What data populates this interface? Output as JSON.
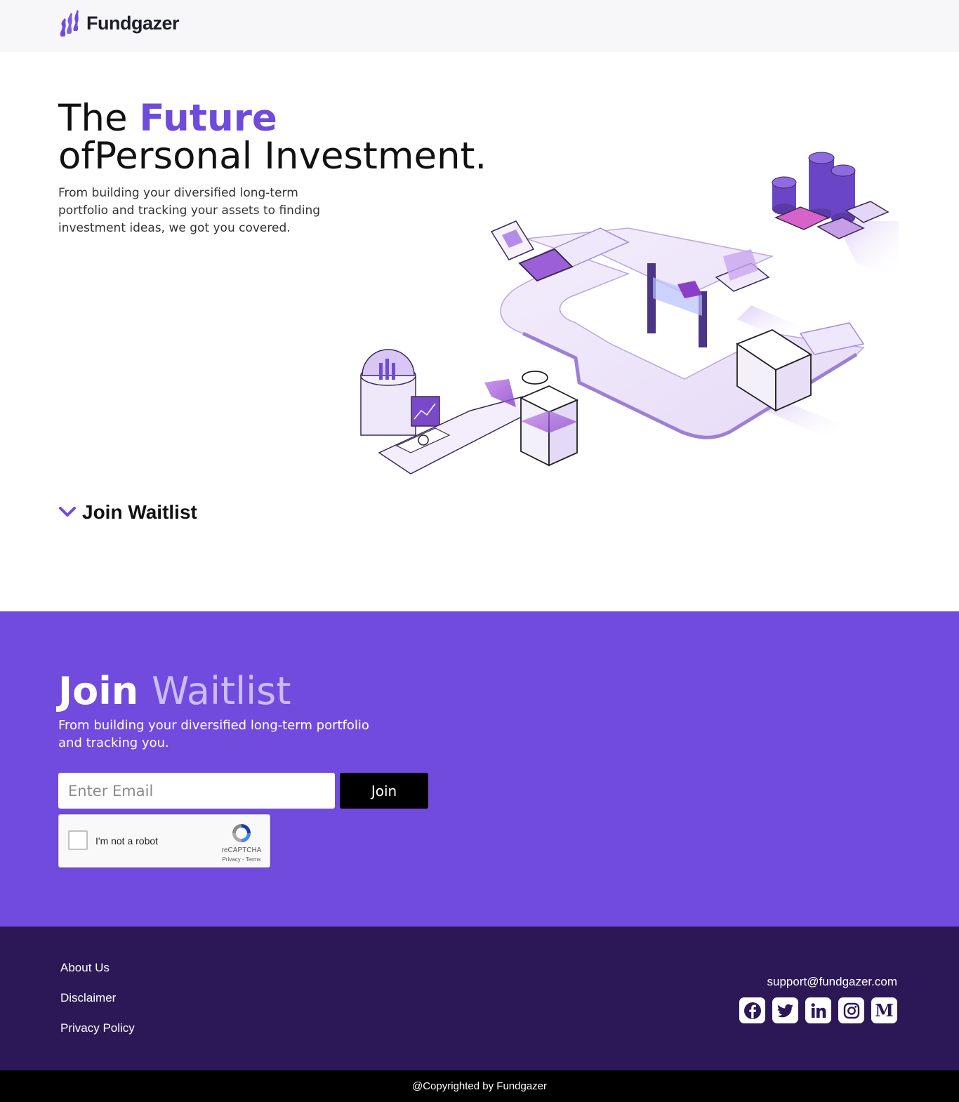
{
  "brand": {
    "name": "Fundgazer",
    "accent": "#6f4bdb",
    "footer_bg": "#2c1857",
    "waitlist_bg": "#714bdd"
  },
  "hero": {
    "title_prefix": "The ",
    "title_accent": "Future",
    "title_line2": "ofPersonal Investment.",
    "subtitle": "From building your diversified long-term portfolio and tracking your assets to finding investment ideas, we got you covered."
  },
  "toggle": {
    "label": "Join Waitlist",
    "icon": "chevron-down-icon"
  },
  "waitlist": {
    "title_bold": "Join",
    "title_light": "Waitlist",
    "subtitle": "From building your diversified long-term portfolio and tracking you.",
    "email_placeholder": "Enter Email",
    "button_label": "Join"
  },
  "captcha": {
    "label": "I'm not a robot",
    "brand": "reCAPTCHA",
    "links": "Privacy - Terms"
  },
  "footer": {
    "links": [
      {
        "label": "About Us"
      },
      {
        "label": "Disclaimer"
      },
      {
        "label": "Privacy Policy"
      }
    ],
    "email": "support@fundgazer.com",
    "socials": [
      "facebook-icon",
      "twitter-icon",
      "linkedin-icon",
      "instagram-icon",
      "medium-icon"
    ]
  },
  "copyright": "@Copyrighted by Fundgazer"
}
